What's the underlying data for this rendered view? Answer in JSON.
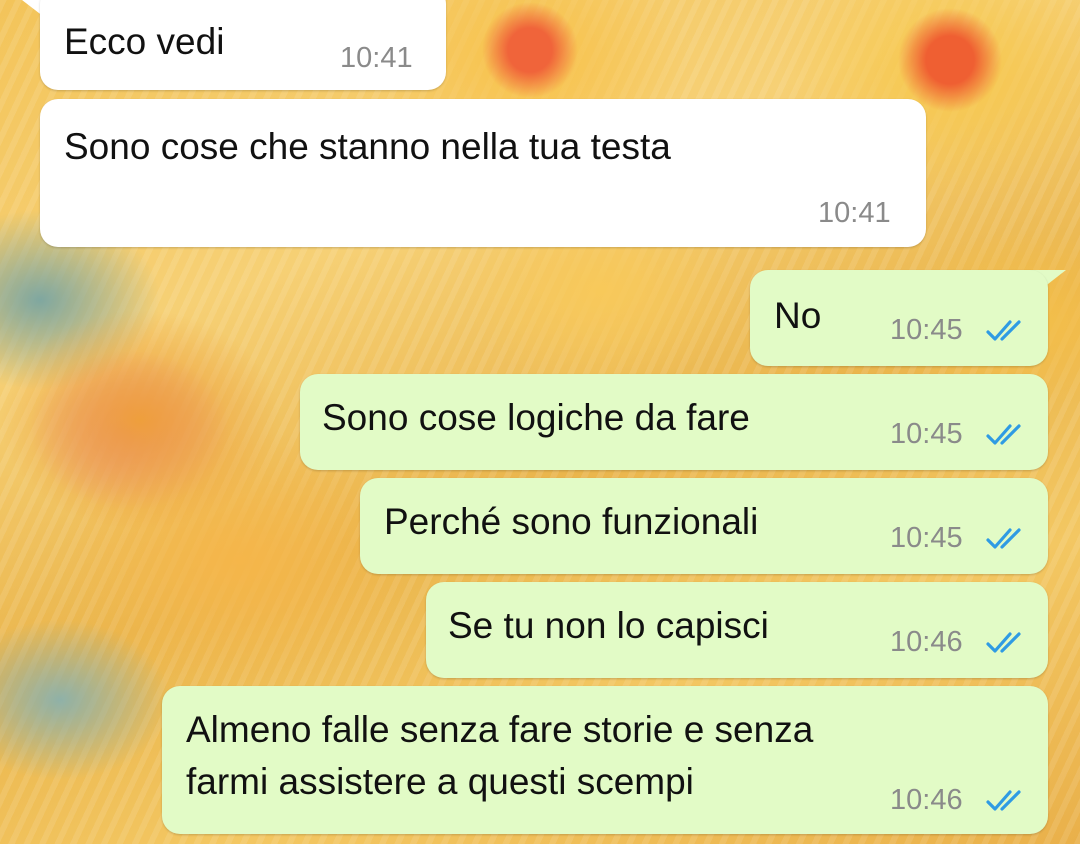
{
  "colors": {
    "incoming_bubble": "#ffffff",
    "outgoing_bubble": "#e2fbc6",
    "read_ticks": "#2f9be3",
    "timestamp": "#8a8a8a"
  },
  "messages": [
    {
      "direction": "incoming",
      "text": "Ecco vedi",
      "time": "10:41"
    },
    {
      "direction": "incoming",
      "text": "Sono cose che stanno nella tua testa",
      "time": "10:41"
    },
    {
      "direction": "outgoing",
      "text": "No",
      "time": "10:45",
      "status": "read-double-check-icon"
    },
    {
      "direction": "outgoing",
      "text": "Sono cose logiche da fare",
      "time": "10:45",
      "status": "read-double-check-icon"
    },
    {
      "direction": "outgoing",
      "text": "Perché sono funzionali",
      "time": "10:45",
      "status": "read-double-check-icon"
    },
    {
      "direction": "outgoing",
      "text": "Se tu non lo capisci",
      "time": "10:46",
      "status": "read-double-check-icon"
    },
    {
      "direction": "outgoing",
      "text_lines": [
        "Almeno falle senza fare storie e senza",
        "farmi assistere a questi scempi"
      ],
      "time": "10:46",
      "status": "read-double-check-icon"
    }
  ]
}
